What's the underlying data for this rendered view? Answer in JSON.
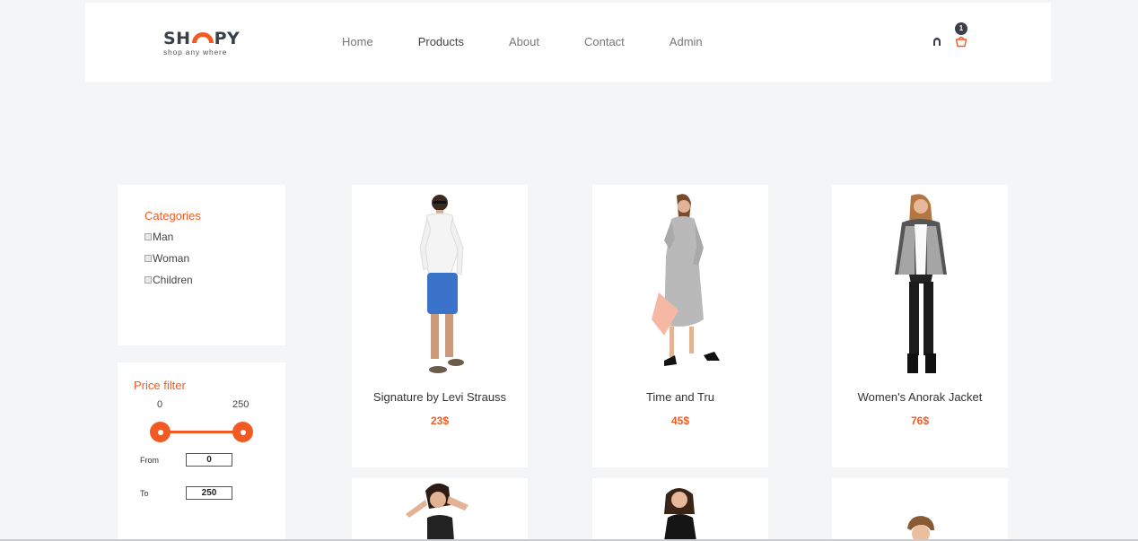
{
  "brand": {
    "name_left": "SH",
    "name_right": "PY",
    "tagline": "shop any where",
    "accent": "#f15a22"
  },
  "nav": [
    {
      "label": "Home",
      "active": false
    },
    {
      "label": "Products",
      "active": true
    },
    {
      "label": "About",
      "active": false
    },
    {
      "label": "Contact",
      "active": false
    },
    {
      "label": "Admin",
      "active": false
    }
  ],
  "header_icons": {
    "user": "user-icon",
    "cart": "basket-icon",
    "cart_count": "1"
  },
  "categories": {
    "title": "Categories",
    "items": [
      {
        "label": "Man",
        "checked": false
      },
      {
        "label": "Woman",
        "checked": false
      },
      {
        "label": "Children",
        "checked": false
      }
    ]
  },
  "price_filter": {
    "title": "Price filter",
    "min_label": "0",
    "max_label": "250",
    "from_label": "From",
    "from_value": "0",
    "to_label": "To",
    "to_value": "250"
  },
  "products": [
    {
      "name": "Signature by Levi Strauss",
      "price": "23$"
    },
    {
      "name": "Time and Tru",
      "price": "45$"
    },
    {
      "name": "Women's Anorak Jacket",
      "price": "76$"
    },
    {
      "name": "",
      "price": ""
    },
    {
      "name": "",
      "price": ""
    },
    {
      "name": "",
      "price": ""
    }
  ]
}
